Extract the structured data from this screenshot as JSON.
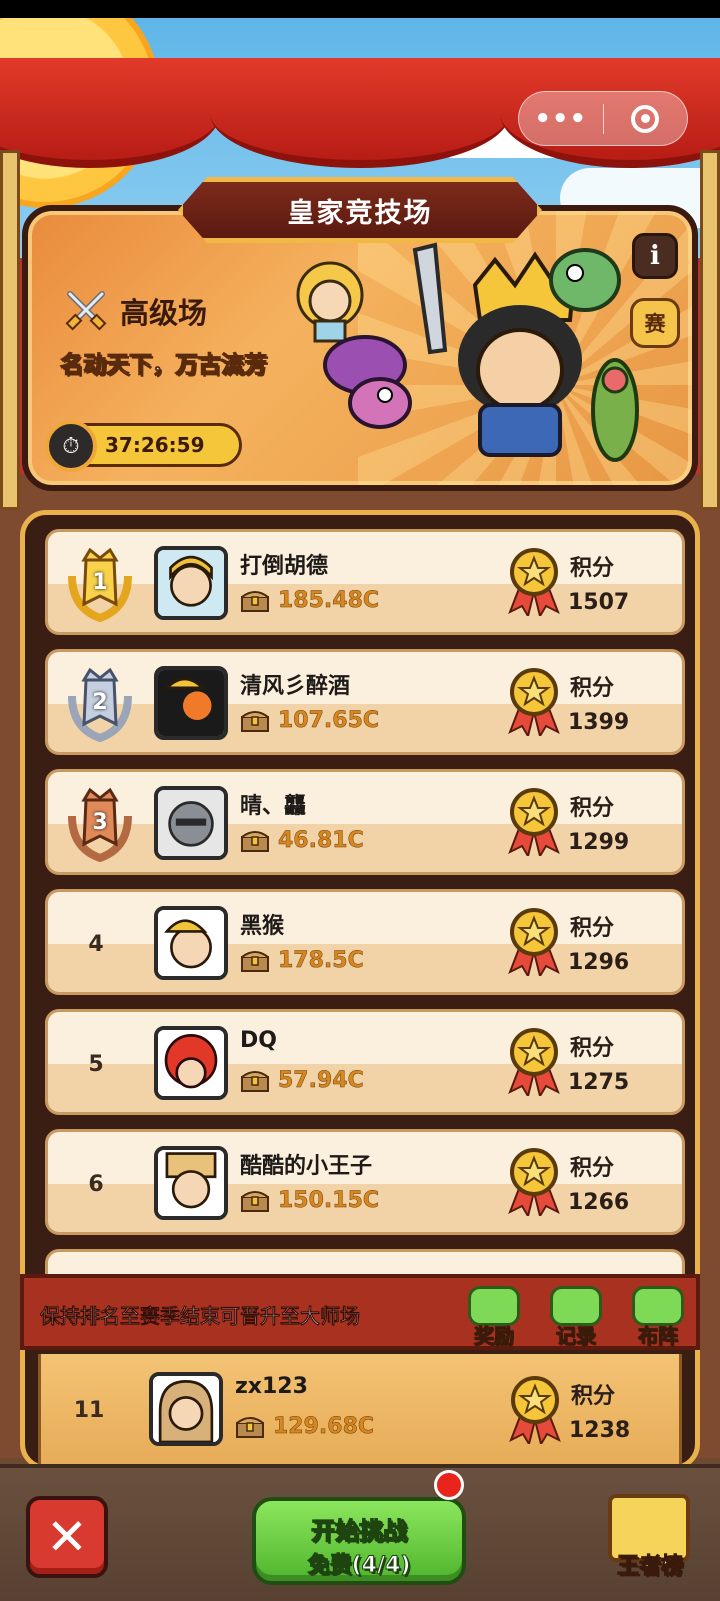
{
  "arena": {
    "title": "皇家竞技场",
    "level_name": "高级场",
    "level_slogan": "名动天下，万古流芳",
    "countdown": "37:26:59",
    "season_badge": "赛",
    "info_icon": "i"
  },
  "leaderboard": [
    {
      "rank": "1",
      "name": "打倒胡德",
      "power": "185.48C",
      "score_label": "积分",
      "score": "1507"
    },
    {
      "rank": "2",
      "name": "清风彡醉酒",
      "power": "107.65C",
      "score_label": "积分",
      "score": "1399"
    },
    {
      "rank": "3",
      "name": "晴、龘",
      "power": "46.81C",
      "score_label": "积分",
      "score": "1299"
    },
    {
      "rank": "4",
      "name": "黑猴",
      "power": "178.5C",
      "score_label": "积分",
      "score": "1296"
    },
    {
      "rank": "5",
      "name": "DQ",
      "power": "57.94C",
      "score_label": "积分",
      "score": "1275"
    },
    {
      "rank": "6",
      "name": "酷酷的小王子",
      "power": "150.15C",
      "score_label": "积分",
      "score": "1266"
    }
  ],
  "promo": {
    "text": "保持排名至赛季结束可晋升至大师场",
    "reward_label": "奖励",
    "record_label": "记录",
    "formation_label": "布阵"
  },
  "my_entry": {
    "rank": "11",
    "name": "zx123",
    "power": "129.68C",
    "score_label": "积分",
    "score": "1238"
  },
  "bottom": {
    "close_icon": "✕",
    "start_line1": "开始挑战",
    "start_line2": "免费(4/4)",
    "king_label": "王者榜"
  },
  "colors": {
    "gold": "#f5c53a",
    "panel_border": "#3b1a10",
    "accent_green": "#4fb52d",
    "accent_red": "#d93a2f"
  }
}
